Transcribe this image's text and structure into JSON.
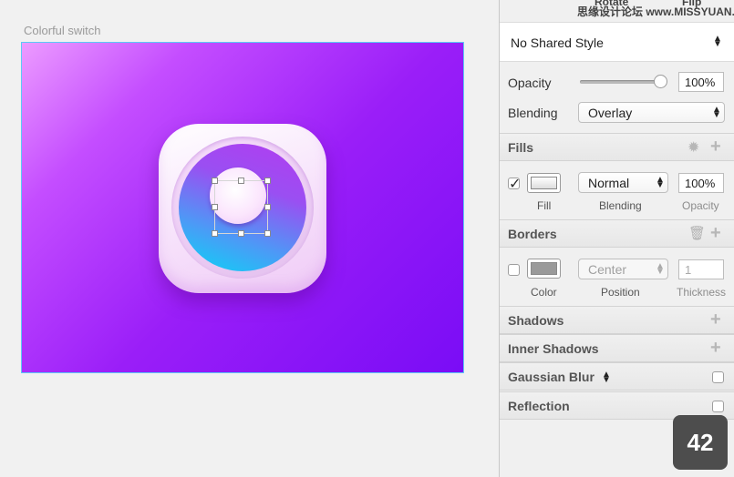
{
  "canvas": {
    "artboard_label": "Colorful switch"
  },
  "inspector": {
    "top_labels": {
      "rotate": "Rotate",
      "flip": "Flip"
    },
    "watermark": "思缘设计论坛 www.MISSYUAN.COM",
    "shared_style": "No Shared Style",
    "opacity": {
      "label": "Opacity",
      "value": "100%",
      "level": 1.0
    },
    "blending": {
      "label": "Blending",
      "value": "Overlay"
    },
    "fills": {
      "title": "Fills",
      "enabled": true,
      "blend": "Normal",
      "opacity": "100%",
      "labels": {
        "fill": "Fill",
        "blending": "Blending",
        "opacity": "Opacity"
      }
    },
    "borders": {
      "title": "Borders",
      "enabled": false,
      "position": "Center",
      "thickness": "1",
      "labels": {
        "color": "Color",
        "position": "Position",
        "thickness": "Thickness"
      }
    },
    "shadows": {
      "title": "Shadows"
    },
    "inner_shadows": {
      "title": "Inner Shadows"
    },
    "gaussian_blur": {
      "title": "Gaussian Blur"
    },
    "reflection": {
      "title": "Reflection"
    }
  },
  "badge": "42",
  "colors": {
    "artboard_border": "#5cc8f5",
    "gradient_start": "#ec9bff",
    "gradient_end": "#7a0cf6",
    "disc_start": "#b23cf0",
    "disc_end": "#08d6f5"
  }
}
